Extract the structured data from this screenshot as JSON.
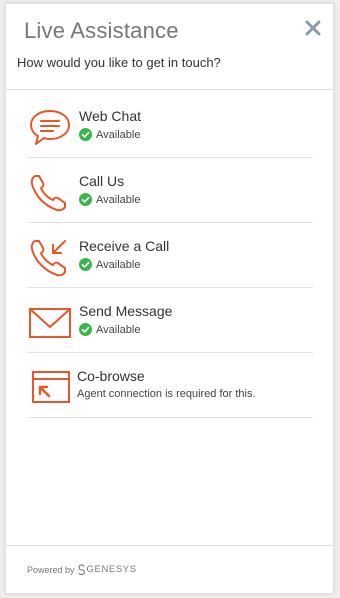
{
  "header": {
    "title": "Live Assistance",
    "subtitle": "How would you like to get in touch?"
  },
  "options": [
    {
      "name": "Web Chat",
      "status": "Available",
      "icon": "chat-bubble-icon"
    },
    {
      "name": "Call Us",
      "status": "Available",
      "icon": "phone-icon"
    },
    {
      "name": "Receive a Call",
      "status": "Available",
      "icon": "incoming-call-icon"
    },
    {
      "name": "Send Message",
      "status": "Available",
      "icon": "envelope-icon"
    },
    {
      "name": "Co-browse",
      "status": "Agent connection is required for this.",
      "icon": "cobrowse-window-icon"
    }
  ],
  "footer": {
    "powered_by": "Powered by",
    "brand": "GENESYS"
  },
  "colors": {
    "accent": "#e8562a",
    "available": "#3bb54a",
    "title": "#777777",
    "close": "#8a9aa9"
  }
}
